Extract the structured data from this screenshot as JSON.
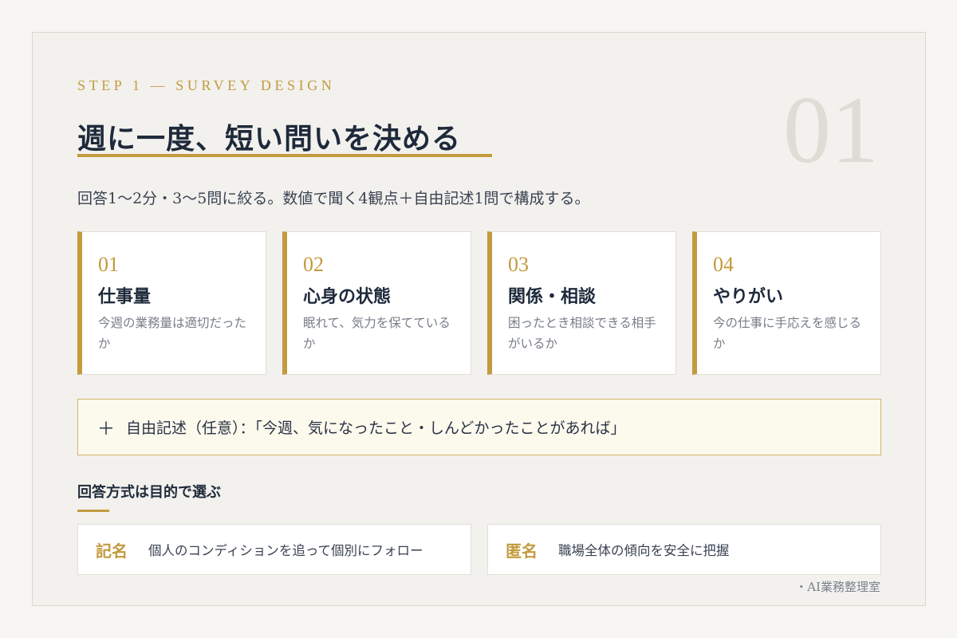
{
  "header": {
    "step_label": "STEP 1 — SURVEY DESIGN",
    "big_number": "01",
    "title": "週に一度、短い問いを決める",
    "lead": "回答1〜2分・3〜5問に絞る。数値で聞く4観点＋自由記述1問で構成する。"
  },
  "cards": [
    {
      "num": "01",
      "title": "仕事量",
      "desc": "今週の業務量は適切だったか"
    },
    {
      "num": "02",
      "title": "心身の状態",
      "desc": "眠れて、気力を保てているか"
    },
    {
      "num": "03",
      "title": "関係・相談",
      "desc": "困ったとき相談できる相手がいるか"
    },
    {
      "num": "04",
      "title": "やりがい",
      "desc": "今の仕事に手応えを感じるか"
    }
  ],
  "free_text": {
    "plus": "＋",
    "label": "自由記述（任意）：「今週、気になったこと・しんどかったことがあれば」"
  },
  "methods": {
    "title": "回答方式は目的で選ぶ",
    "items": [
      {
        "name": "記名",
        "desc": "個人のコンディションを追って個別にフォロー"
      },
      {
        "name": "匿名",
        "desc": "職場全体の傾向を安全に把握"
      }
    ]
  },
  "footer": "・AI業務整理室"
}
